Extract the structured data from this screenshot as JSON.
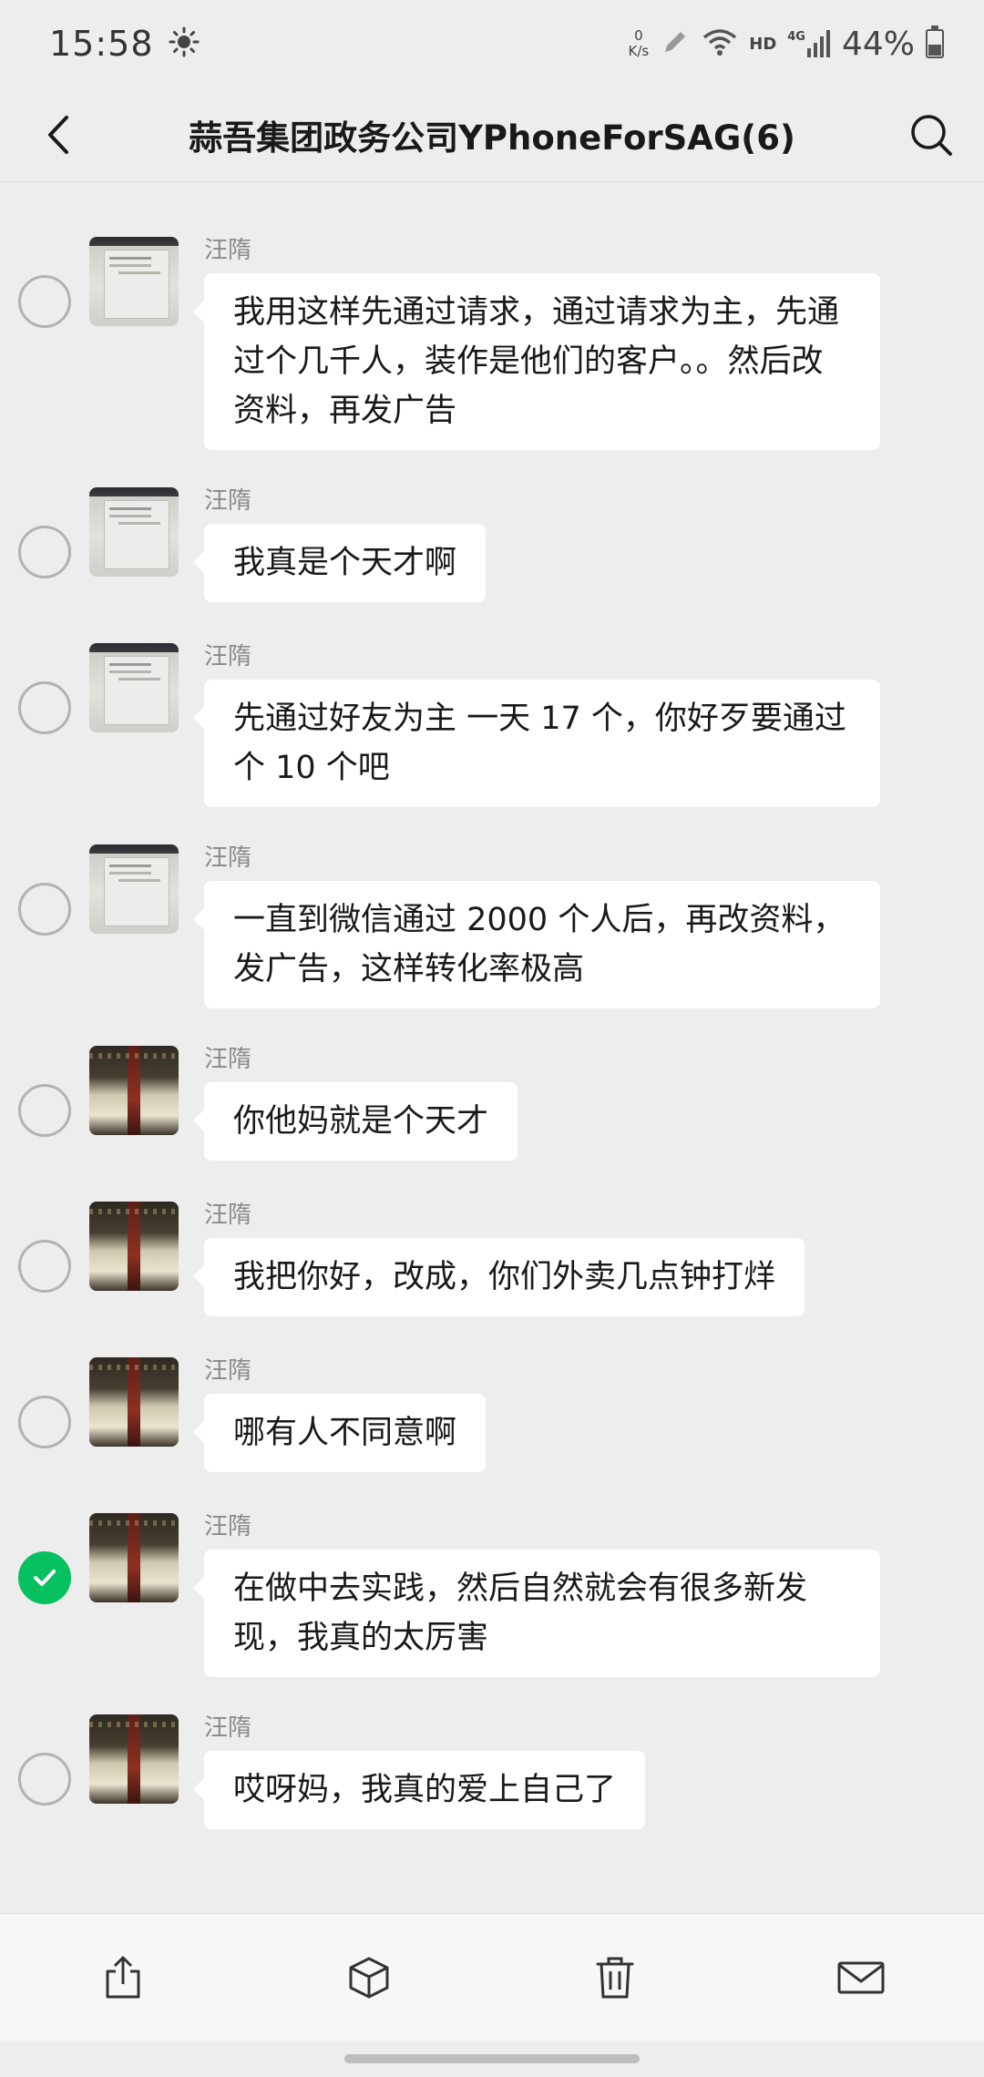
{
  "status_bar": {
    "time": "15:58",
    "net_speed_value": "0",
    "net_speed_unit": "K/s",
    "hd": "HD",
    "network": "4G",
    "battery": "44%"
  },
  "header": {
    "title": "蒜吾集团政务公司YPhoneForSAG(6)"
  },
  "messages": [
    {
      "sender": "汪隋",
      "text": "我用这样先通过请求，通过请求为主，先通过个几千人，装作是他们的客户。。然后改资料，再发广告",
      "selected": false,
      "avatar": "paper"
    },
    {
      "sender": "汪隋",
      "text": "我真是个天才啊",
      "selected": false,
      "avatar": "paper"
    },
    {
      "sender": "汪隋",
      "text": "先通过好友为主 一天 17 个，你好歹要通过个 10 个吧",
      "selected": false,
      "avatar": "paper"
    },
    {
      "sender": "汪隋",
      "text": "一直到微信通过 2000 个人后，再改资料，发广告，这样转化率极高",
      "selected": false,
      "avatar": "paper"
    },
    {
      "sender": "汪隋",
      "text": "你他妈就是个天才",
      "selected": false,
      "avatar": "dark"
    },
    {
      "sender": "汪隋",
      "text": "我把你好，改成，你们外卖几点钟打烊",
      "selected": false,
      "avatar": "dark"
    },
    {
      "sender": "汪隋",
      "text": "哪有人不同意啊",
      "selected": false,
      "avatar": "dark"
    },
    {
      "sender": "汪隋",
      "text": "在做中去实践，然后自然就会有很多新发现，我真的太厉害",
      "selected": true,
      "avatar": "dark"
    },
    {
      "sender": "汪隋",
      "text": "哎呀妈，我真的爱上自己了",
      "selected": false,
      "avatar": "dark"
    }
  ],
  "toolbar": {
    "icons": [
      "share-icon",
      "box-icon",
      "trash-icon",
      "mail-icon"
    ]
  },
  "colors": {
    "background": "#ededed",
    "bubble": "#ffffff",
    "check_green": "#07c160"
  }
}
